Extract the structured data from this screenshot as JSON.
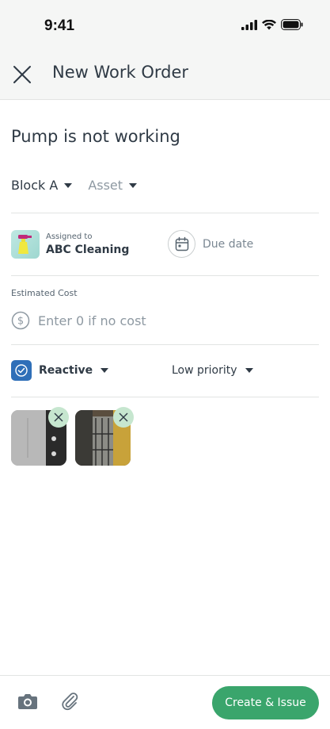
{
  "status_bar": {
    "time": "9:41"
  },
  "header": {
    "title": "New Work Order"
  },
  "form": {
    "title_value": "Pump is not working",
    "location_label": "Block A",
    "asset_placeholder": "Asset",
    "assigned_label": "Assigned to",
    "assigned_value": "ABC Cleaning",
    "due_date_placeholder": "Due date",
    "estimated_cost_label": "Estimated Cost",
    "estimated_cost_placeholder": "Enter 0 if no cost",
    "type_label": "Reactive",
    "priority_label": "Low priority"
  },
  "attachments": [
    {
      "name": "photo-1"
    },
    {
      "name": "photo-2"
    }
  ],
  "footer": {
    "primary_button": "Create & Issue"
  },
  "colors": {
    "primary": "#3aa56c",
    "type_badge": "#2f6fb8",
    "text": "#2f3a45"
  },
  "icons": [
    "close-icon",
    "calendar-icon",
    "dollar-icon",
    "check-icon",
    "camera-icon",
    "paperclip-icon"
  ]
}
